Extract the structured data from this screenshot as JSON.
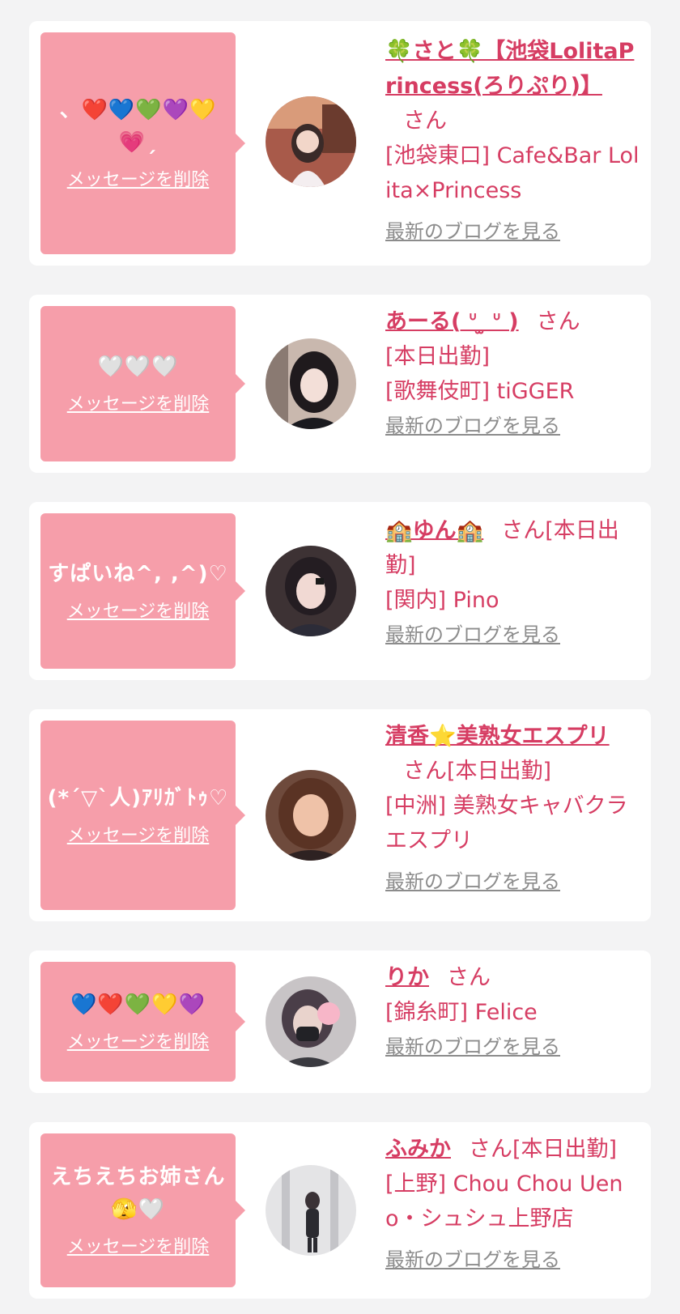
{
  "delete_label": "メッセージを削除",
  "blog_label": "最新のブログを見る",
  "honorific": "さん",
  "colors": {
    "bubble": "#f69eaa",
    "accent": "#d63d63",
    "link_gray": "#8c8c8c",
    "background": "#f3f3f4"
  },
  "items": [
    {
      "message": "、❤️💙💚💜💛💗ˏ",
      "name": "🍀さと🍀【池袋LolitaPrincess(ろりぷり)】",
      "status": "",
      "shop": "[池袋東口] Cafe&Bar Lolita×Princess",
      "avatar_icon": "avatar-photo"
    },
    {
      "message": "🤍🤍🤍",
      "name": "あーる( ᐡ ̫ ᐡ )",
      "status": "[本日出勤]",
      "shop": "[歌舞伎町] tiGGER",
      "avatar_icon": "avatar-photo"
    },
    {
      "message": "すぱいね^, ,^)♡",
      "name": "🏫ゆん🏫",
      "status": "[本日出勤]",
      "shop": "[関内] Pino",
      "avatar_icon": "avatar-photo"
    },
    {
      "message": "(*´▽`人)ｱﾘｶﾞﾄｩ♡",
      "name": "清香⭐️美熟女エスプリ",
      "status": "[本日出勤]",
      "shop": "[中洲] 美熟女キャバクラ エスプリ",
      "avatar_icon": "avatar-photo"
    },
    {
      "message": "💙❤️💚💛💜",
      "name": "りか",
      "status": "",
      "shop": "[錦糸町] Felice",
      "avatar_icon": "avatar-photo"
    },
    {
      "message": "えちえちお姉さん🫣🤍",
      "name": "ふみか",
      "status": "[本日出勤]",
      "shop": "[上野] Chou Chou Ueno・シュシュ上野店",
      "avatar_icon": "avatar-photo"
    }
  ]
}
